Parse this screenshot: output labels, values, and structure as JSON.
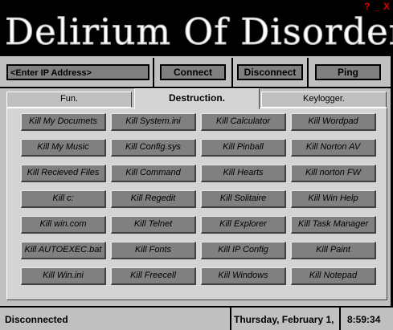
{
  "title": "Delirium Of Disorder",
  "window_controls": [
    "?",
    "_",
    "X"
  ],
  "toolbar": {
    "ip_placeholder": "<Enter IP Address>",
    "connect_label": "Connect",
    "disconnect_label": "Disconnect",
    "ping_label": "Ping"
  },
  "tabs": [
    {
      "label": "Fun."
    },
    {
      "label": "Destruction."
    },
    {
      "label": "Keylogger."
    }
  ],
  "buttons": [
    [
      "Kill My Documets",
      "Kill System.ini",
      "Kill Calculator",
      "Kill Wordpad"
    ],
    [
      "Kill My Music",
      "Kill Config.sys",
      "Kill Pinball",
      "Kill Norton AV"
    ],
    [
      "Kill Recieved Files",
      "Kill Command",
      "Kill Hearts",
      "Kill norton FW"
    ],
    [
      "Kill c:",
      "Kill Regedit",
      "Kill Solitaire",
      "Kill Win Help"
    ],
    [
      "Kill win.com",
      "Kill Telnet",
      "Kill Explorer",
      "Kill Task Manager"
    ],
    [
      "Kill AUTOEXEC.bat",
      "Kill Fonts",
      "Kill IP Config",
      "Kill Paint"
    ],
    [
      "Kill Win.ini",
      "Kill Freecell",
      "Kill Windows",
      "Kill Notepad"
    ]
  ],
  "status": {
    "connection": "Disconnected",
    "date": "Thursday, February 1,",
    "time": "8:59:34"
  }
}
